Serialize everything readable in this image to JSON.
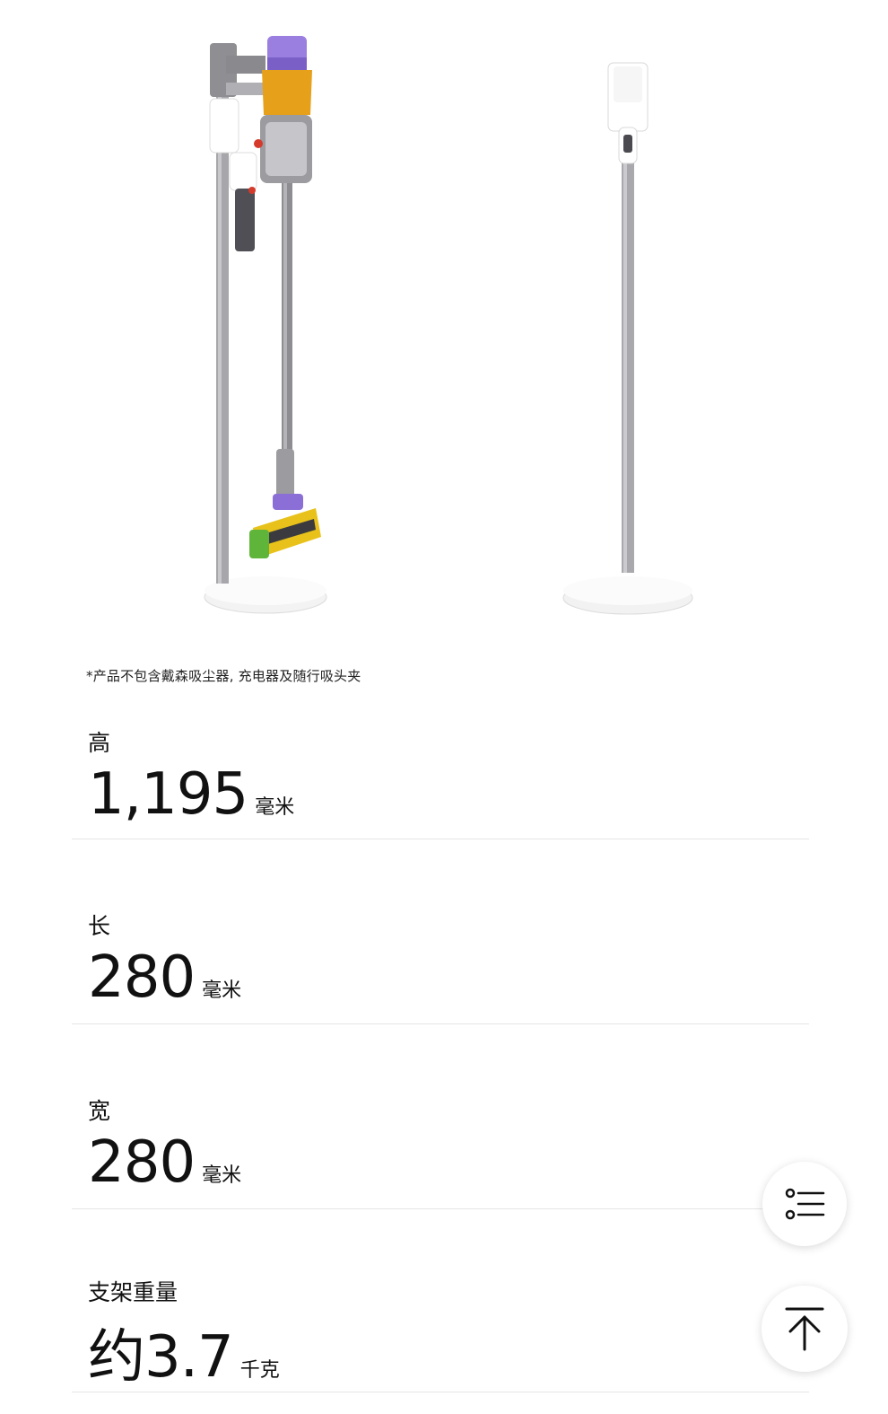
{
  "footnote": "*产品不包含戴森吸尘器, 充电器及随行吸头夹",
  "specs": [
    {
      "label": "高",
      "value": "1,195",
      "unit": "毫米"
    },
    {
      "label": "长",
      "value": "280",
      "unit": "毫米"
    },
    {
      "label": "宽",
      "value": "280",
      "unit": "毫米"
    },
    {
      "label": "支架重量",
      "value": "约3.7",
      "unit": "千克"
    }
  ],
  "icons": {
    "toc": "list-icon",
    "top": "arrow-up-icon"
  },
  "colors": {
    "accent": "#e8a317",
    "purple": "#8b6fd6",
    "pole": "#a9a9ad",
    "base": "#f4f4f4"
  }
}
